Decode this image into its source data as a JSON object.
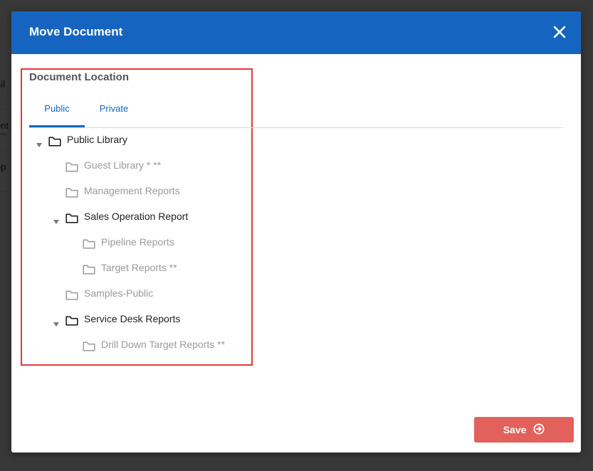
{
  "background": {
    "rows": [
      {
        "label": "nil"
      },
      {
        "label": "ont"
      },
      {
        "label": "pp"
      }
    ]
  },
  "dialog": {
    "title": "Move Document",
    "close_icon": "close-icon"
  },
  "location": {
    "label": "Document Location",
    "tabs": [
      {
        "label": "Public",
        "active": true
      },
      {
        "label": "Private",
        "active": false
      }
    ]
  },
  "tree": [
    {
      "label": "Public Library",
      "level": 0,
      "expandable": true,
      "enabled": true
    },
    {
      "label": "Guest Library * **",
      "level": 1,
      "expandable": false,
      "enabled": false
    },
    {
      "label": "Management Reports",
      "level": 1,
      "expandable": false,
      "enabled": false
    },
    {
      "label": "Sales Operation Report",
      "level": 1,
      "expandable": true,
      "enabled": true
    },
    {
      "label": "Pipeline Reports",
      "level": 2,
      "expandable": false,
      "enabled": false
    },
    {
      "label": "Target Reports **",
      "level": 2,
      "expandable": false,
      "enabled": false
    },
    {
      "label": "Samples-Public",
      "level": 1,
      "expandable": false,
      "enabled": false
    },
    {
      "label": "Service Desk Reports",
      "level": 1,
      "expandable": true,
      "enabled": true
    },
    {
      "label": "Drill Down Target Reports **",
      "level": 2,
      "expandable": false,
      "enabled": false
    }
  ],
  "footer": {
    "save_label": "Save",
    "save_icon": "arrow-right-circle-icon"
  },
  "colors": {
    "header": "#1565c0",
    "save_button": "#e2615c",
    "highlight": "#e53935"
  }
}
